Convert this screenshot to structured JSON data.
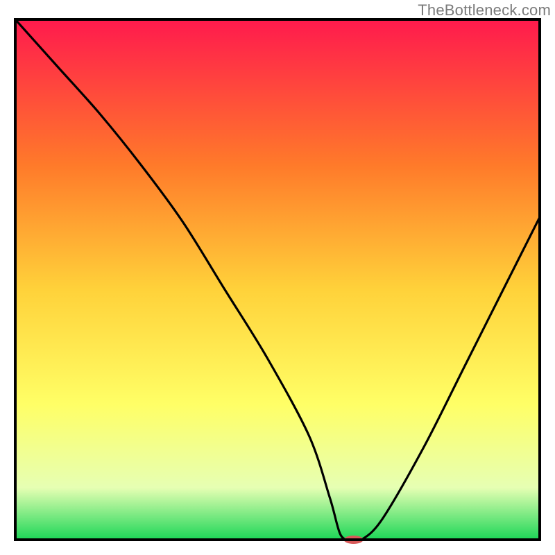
{
  "watermark": "TheBottleneck.com",
  "chart_data": {
    "type": "line",
    "title": "",
    "xlabel": "",
    "ylabel": "",
    "xlim": [
      0,
      100
    ],
    "ylim": [
      0,
      100
    ],
    "x": [
      0,
      8,
      16,
      24,
      32,
      40,
      48,
      56,
      60,
      62,
      64,
      66,
      70,
      78,
      86,
      94,
      100
    ],
    "values": [
      100,
      91,
      82,
      72,
      61,
      48,
      35,
      20,
      8,
      1,
      0,
      0,
      4,
      18,
      34,
      50,
      62
    ],
    "grid": false,
    "legend": false,
    "colors": {
      "gradient_top": "#ff1a4d",
      "gradient_mid_upper": "#ff7a2a",
      "gradient_mid": "#ffd23a",
      "gradient_mid_lower": "#ffff66",
      "gradient_near_bottom": "#e6ffb3",
      "gradient_bottom": "#1cd657",
      "curve": "#000000",
      "frame": "#000000",
      "marker": "#d85a5a"
    },
    "marker": {
      "x": 64.5,
      "y": 0,
      "rx": 14,
      "ry": 6
    }
  }
}
